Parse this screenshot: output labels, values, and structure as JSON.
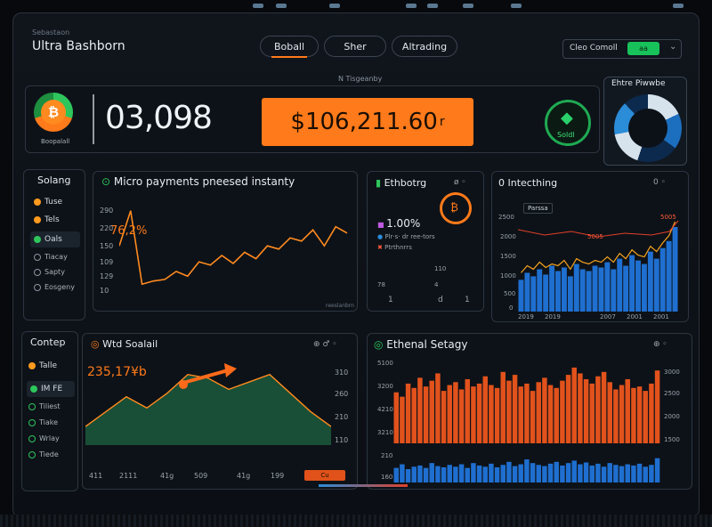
{
  "header": {
    "subtitle": "Sebastaon",
    "app_title": "Ultra Bashborn",
    "tabs": [
      {
        "label": "Boball",
        "active": true
      },
      {
        "label": "Sher"
      },
      {
        "label": "Altrading"
      }
    ],
    "top_right": {
      "label": "Cleo  Comoll",
      "button": "aa"
    },
    "center_label": "N Tisgeanby"
  },
  "hero": {
    "coin_label": "Boopalall",
    "big_number": "03,098",
    "price": "$106,211.60",
    "price_suffix": "r",
    "eth_label": "Soldl"
  },
  "donut": {
    "title": "Ehtre Piwwbe"
  },
  "sidebar_top": {
    "title": "Solang",
    "items": [
      {
        "label": "Tuse",
        "color": "#ff9a1f"
      },
      {
        "label": "Tels",
        "color": "#ff9a1f"
      },
      {
        "label": "Oals",
        "color": "#2ec65c"
      },
      {
        "label": "Tiacay",
        "color": "#8b95a1"
      },
      {
        "label": "Sapty",
        "color": "#8b95a1"
      },
      {
        "label": "Eosgeny",
        "color": "#8b95a1"
      }
    ]
  },
  "micro_panel": {
    "title": "Micro payments pneesed instanty",
    "percent": "76,2%",
    "y_ticks": [
      "290",
      "220",
      "150",
      "109",
      "129",
      "10"
    ],
    "footer": "reeslanbrn"
  },
  "ethbot_panel": {
    "title": "Ethbotrg",
    "stat": "1.00%",
    "lines": [
      "Plr·s· dr ree-tors",
      "Ptrthnrrs"
    ],
    "ticks": [
      "110",
      "78",
      "4",
      "1",
      "d",
      "1"
    ]
  },
  "interest_panel": {
    "title": "0 Intecthing",
    "legend": "Parssa",
    "y_ticks": [
      "2500",
      "2000",
      "1500",
      "1000",
      "500",
      "0"
    ],
    "x_ticks": [
      "2019",
      "2019",
      "2007",
      "2001",
      "2001"
    ],
    "red_tags": [
      "5005",
      "5005"
    ]
  },
  "sidebar_bottom": {
    "title": "Contep",
    "items": [
      {
        "label": "Talle",
        "color": "#ff9a1f"
      },
      {
        "label": "IM FE",
        "color": "#2ec65c"
      },
      {
        "label": "Tiliest"
      },
      {
        "label": "Tiake"
      },
      {
        "label": "Wrlay"
      },
      {
        "label": "Tiede"
      }
    ]
  },
  "wed_panel": {
    "title": "Wtd Soalail",
    "value": "235,17¥b",
    "y_ticks": [
      "310",
      "260",
      "210",
      "110"
    ],
    "x_ticks": [
      "411",
      "2111",
      "41g",
      "509",
      "41g",
      "199"
    ],
    "button": "Cu"
  },
  "ethenal_panel": {
    "title": "Ethenal Setagy",
    "y_ticks_left": [
      "5100",
      "3200",
      "4210",
      "3210",
      "210",
      "160"
    ],
    "y_ticks_right": [
      "3000",
      "2500",
      "2000",
      "1500"
    ]
  },
  "chart_data": [
    {
      "type": "line",
      "title": "Micro payments pneesed instanty",
      "x": [
        0,
        1,
        2,
        3,
        4,
        5,
        6,
        7,
        8,
        9,
        10,
        11,
        12,
        13,
        14,
        15,
        16,
        17,
        18,
        19,
        20
      ],
      "series": [
        {
          "values": [
            150,
            260,
            30,
            40,
            45,
            70,
            55,
            100,
            90,
            120,
            95,
            130,
            110,
            150,
            140,
            175,
            165,
            200,
            150,
            210,
            190
          ]
        }
      ]
    },
    {
      "type": "bar",
      "title": "0 Intecthing",
      "ylim": [
        0,
        2500
      ],
      "series": [
        {
          "values": [
            900,
            1100,
            1000,
            1200,
            1050,
            1300,
            1150,
            1250,
            1000,
            1350,
            1200,
            1150,
            1300,
            1250,
            1400,
            1200,
            1500,
            1300,
            1600,
            1450,
            1350,
            1700,
            1500,
            1800,
            2000,
            2400
          ]
        },
        {
          "values": [
            1000,
            1200,
            1100,
            1300,
            1150,
            1250,
            1200,
            1350,
            1100,
            1400,
            1300,
            1250,
            1350,
            1300,
            1450,
            1300,
            1550,
            1400,
            1650,
            1500,
            1450,
            1750,
            1600,
            1850,
            2050,
            2450
          ]
        }
      ]
    },
    {
      "type": "area",
      "title": "Wtd Soalail",
      "x": [
        0,
        1,
        2,
        3,
        4,
        5,
        6,
        7,
        8,
        9,
        10,
        11,
        12
      ],
      "series": [
        {
          "values": [
            110,
            150,
            190,
            160,
            200,
            250,
            240,
            210,
            230,
            250,
            200,
            150,
            110
          ]
        }
      ]
    },
    {
      "type": "bar",
      "title": "Ethenal Setagy",
      "series": [
        {
          "name": "orange",
          "values": [
            3500,
            3200,
            4100,
            3800,
            4500,
            3900,
            4300,
            4800,
            3600,
            4000,
            4200,
            3700,
            4400,
            3900,
            4100,
            4600,
            4000,
            3800,
            4900,
            4300,
            4700,
            3900,
            4100,
            3600,
            4200,
            4500,
            4000,
            3800,
            4300,
            4700,
            5200,
            4800,
            4400,
            4100,
            4600,
            4900,
            4200,
            3700,
            4000,
            4400,
            3800,
            3900,
            3600,
            4100,
            5000
          ]
        },
        {
          "name": "blue",
          "values": [
            1200,
            1500,
            1100,
            1300,
            1400,
            1200,
            1600,
            1350,
            1250,
            1450,
            1300,
            1500,
            1200,
            1600,
            1400,
            1300,
            1550,
            1250,
            1450,
            1700,
            1350,
            1500,
            1900,
            1600,
            1450,
            1350,
            1550,
            1700,
            1400,
            1600,
            1800,
            1500,
            1650,
            1400,
            1550,
            1300,
            1600,
            1450,
            1350,
            1500,
            1400,
            1550,
            1300,
            1450,
            2000
          ]
        }
      ]
    }
  ]
}
